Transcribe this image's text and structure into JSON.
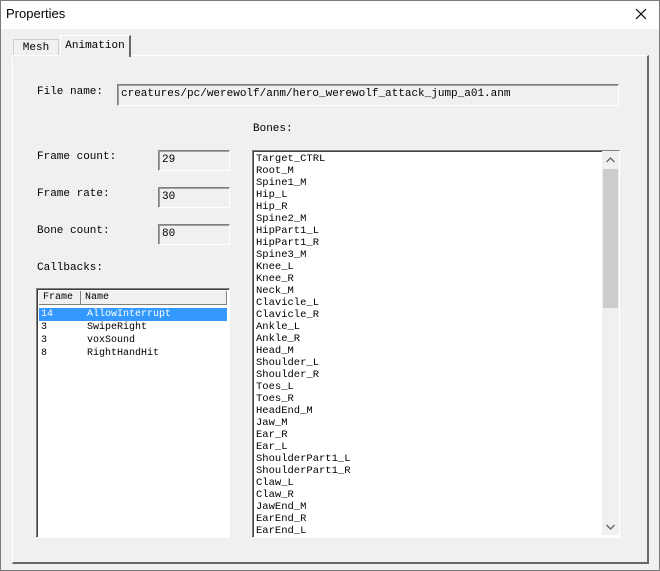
{
  "window": {
    "title": "Properties"
  },
  "tabs": [
    {
      "label": "Mesh"
    },
    {
      "label": "Animation"
    }
  ],
  "file": {
    "label": "File name:",
    "value": "creatures/pc/werewolf/anm/hero_werewolf_attack_jump_a01.anm"
  },
  "frame_count": {
    "label": "Frame count:",
    "value": "29"
  },
  "frame_rate": {
    "label": "Frame rate:",
    "value": "30"
  },
  "bone_count": {
    "label": "Bone count:",
    "value": "80"
  },
  "callbacks": {
    "label": "Callbacks:",
    "columns": [
      "Frame",
      "Name"
    ],
    "rows": [
      {
        "frame": "14",
        "name": "AllowInterrupt",
        "selected": true
      },
      {
        "frame": "3",
        "name": "SwipeRight",
        "selected": false
      },
      {
        "frame": "3",
        "name": "voxSound",
        "selected": false
      },
      {
        "frame": "8",
        "name": "RightHandHit",
        "selected": false
      }
    ]
  },
  "bones": {
    "label": "Bones:",
    "items": [
      "Target_CTRL",
      "Root_M",
      "Spine1_M",
      "Hip_L",
      "Hip_R",
      "Spine2_M",
      "HipPart1_L",
      "HipPart1_R",
      "Spine3_M",
      "Knee_L",
      "Knee_R",
      "Neck_M",
      "Clavicle_L",
      "Clavicle_R",
      "Ankle_L",
      "Ankle_R",
      "Head_M",
      "Shoulder_L",
      "Shoulder_R",
      "Toes_L",
      "Toes_R",
      "HeadEnd_M",
      "Jaw_M",
      "Ear_R",
      "Ear_L",
      "ShoulderPart1_L",
      "ShoulderPart1_R",
      "Claw_L",
      "Claw_R",
      "JawEnd_M",
      "EarEnd_R",
      "EarEnd_L"
    ]
  },
  "icons": {
    "close": "close-icon",
    "scroll_up": "chevron-up-icon",
    "scroll_down": "chevron-down-icon"
  },
  "colors": {
    "selection": "#3399ff",
    "window_bg": "#f0f0f0"
  }
}
